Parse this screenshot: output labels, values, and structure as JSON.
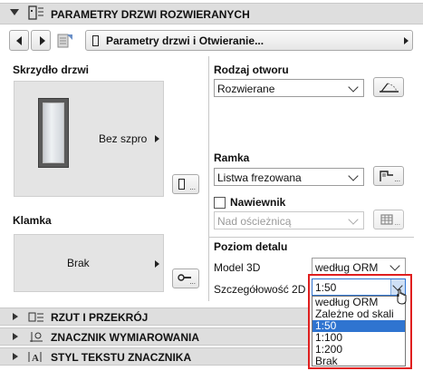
{
  "header": {
    "title": "PARAMETRY DRZWI ROZWIERANYCH"
  },
  "toolbar": {
    "path_label": "Parametry drzwi i Otwieranie..."
  },
  "left": {
    "leaf_label": "Skrzydło drzwi",
    "leaf_preview_label": "Bez szpro",
    "handle_label": "Klamka",
    "handle_preview_label": "Brak"
  },
  "right": {
    "opening_label": "Rodzaj otworu",
    "opening_value": "Rozwierane",
    "frame_label": "Ramka",
    "frame_value": "Listwa frezowana",
    "vent_label": "Nawiewnik",
    "vent_value": "Nad ościeżnicą",
    "detail_label": "Poziom detalu",
    "model3d_label": "Model 3D",
    "model3d_value": "według ORM",
    "detail2d_label": "Szczegółowość 2D",
    "detail2d_value": "1:50",
    "detail2d_options": [
      "według ORM",
      "Zależne od skali",
      "1:50",
      "1:100",
      "1:200",
      "Brak"
    ],
    "detail2d_selected": "1:50"
  },
  "sections": [
    {
      "label": "RZUT I PRZEKRÓJ"
    },
    {
      "label": "ZNACZNIK WYMIAROWANIA"
    },
    {
      "label": "STYL TEKSTU ZNACZNIKA"
    }
  ],
  "colors": {
    "highlight_border": "#e01f1f",
    "selection": "#2f74d0",
    "door_frame": "#5a5a5a"
  }
}
